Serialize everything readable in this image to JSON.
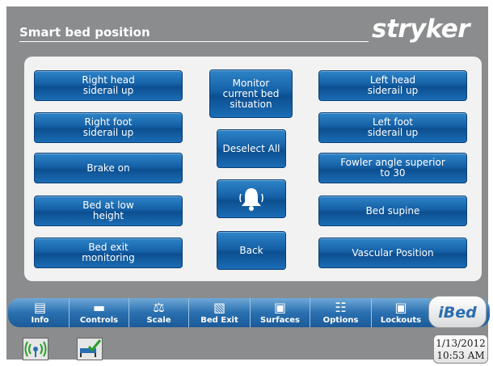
{
  "header": {
    "title": "Smart bed position",
    "brand": "stryker"
  },
  "buttons": {
    "right_head": "Right head\nsiderail up",
    "right_foot": "Right foot\nsiderail up",
    "brake_on": "Brake on",
    "bed_low": "Bed at low\nheight",
    "bed_exit_monitoring": "Bed exit\nmonitoring",
    "monitor_current": "Monitor\ncurrent bed\nsituation",
    "deselect_all": "Deselect All",
    "back": "Back",
    "left_head": "Left head\nsiderail up",
    "left_foot": "Left foot\nsiderail up",
    "fowler": "Fowler angle superior\nto 30",
    "bed_supine": "Bed supine",
    "vascular": "Vascular Position"
  },
  "tabs": [
    {
      "label": "Info",
      "icon": "info-icon"
    },
    {
      "label": "Controls",
      "icon": "controls-icon"
    },
    {
      "label": "Scale",
      "icon": "scale-icon"
    },
    {
      "label": "Bed Exit",
      "icon": "bed-exit-icon"
    },
    {
      "label": "Surfaces",
      "icon": "surfaces-icon"
    },
    {
      "label": "Options",
      "icon": "options-icon"
    },
    {
      "label": "Lockouts",
      "icon": "lock-icon"
    }
  ],
  "ibed_label": "iBed",
  "status": {
    "date": "1/13/2012",
    "time": "10:53 AM"
  },
  "colors": {
    "button_blue": "#1560a6",
    "background_gray": "#8a8c8e",
    "panel": "#f2f2f2"
  }
}
